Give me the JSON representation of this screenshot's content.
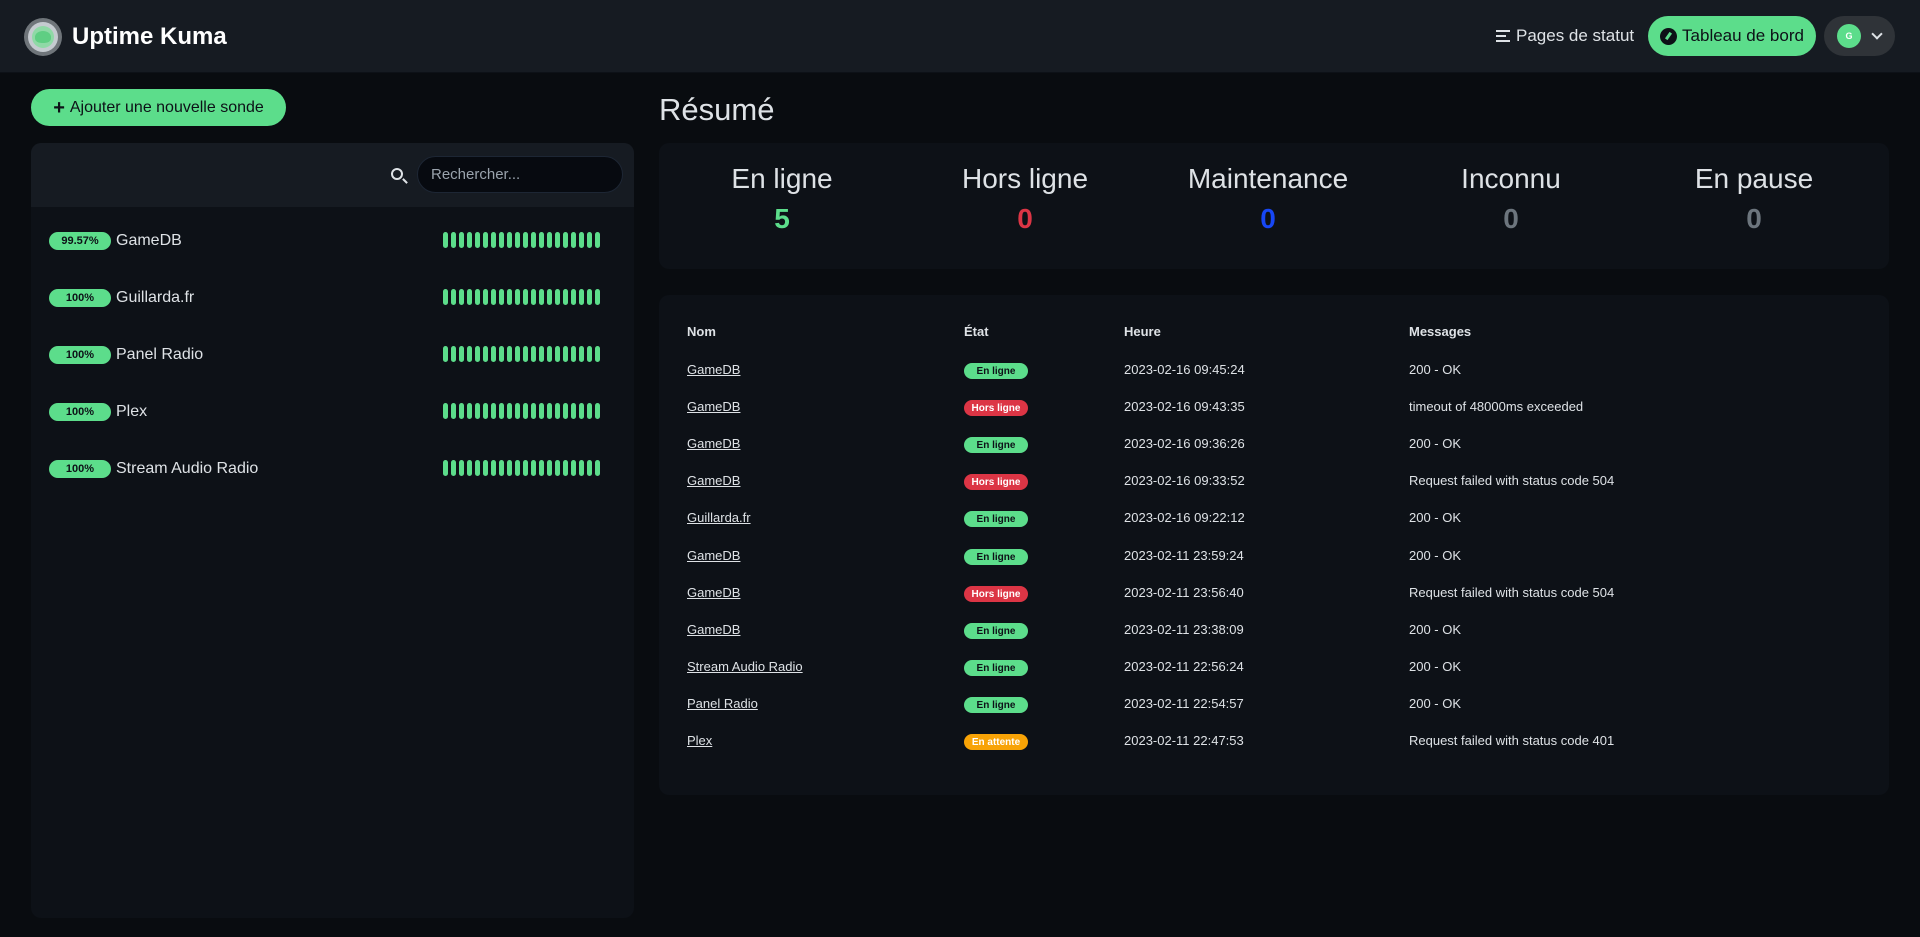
{
  "header": {
    "app_title": "Uptime Kuma",
    "status_pages_label": "Pages de statut",
    "dashboard_label": "Tableau de bord",
    "avatar_initial": "G",
    "logo_icon": "uptime-kuma-logo-icon"
  },
  "sidebar": {
    "add_button_label": "Ajouter une nouvelle sonde",
    "search_placeholder": "Rechercher...",
    "monitors": [
      {
        "uptime": "99.57%",
        "name": "GameDB"
      },
      {
        "uptime": "100%",
        "name": "Guillarda.fr"
      },
      {
        "uptime": "100%",
        "name": "Panel Radio"
      },
      {
        "uptime": "100%",
        "name": "Plex"
      },
      {
        "uptime": "100%",
        "name": "Stream Audio Radio"
      }
    ],
    "heartbeat_color": "#5cdd8b"
  },
  "summary": {
    "title": "Résumé",
    "stats": [
      {
        "label": "En ligne",
        "value": "5",
        "color": "#5cdd8b"
      },
      {
        "label": "Hors ligne",
        "value": "0",
        "color": "#dc3545"
      },
      {
        "label": "Maintenance",
        "value": "0",
        "color": "#1747f5"
      },
      {
        "label": "Inconnu",
        "value": "0",
        "color": "#6c757d"
      },
      {
        "label": "En pause",
        "value": "0",
        "color": "#6c757d"
      }
    ]
  },
  "events": {
    "headers": {
      "name": "Nom",
      "state": "État",
      "time": "Heure",
      "message": "Messages"
    },
    "rows": [
      {
        "name": "GameDB",
        "state": "En ligne",
        "status": "up",
        "time": "2023-02-16 09:45:24",
        "message": "200 - OK"
      },
      {
        "name": "GameDB",
        "state": "Hors ligne",
        "status": "down",
        "time": "2023-02-16 09:43:35",
        "message": "timeout of 48000ms exceeded"
      },
      {
        "name": "GameDB",
        "state": "En ligne",
        "status": "up",
        "time": "2023-02-16 09:36:26",
        "message": "200 - OK"
      },
      {
        "name": "GameDB",
        "state": "Hors ligne",
        "status": "down",
        "time": "2023-02-16 09:33:52",
        "message": "Request failed with status code 504"
      },
      {
        "name": "Guillarda.fr",
        "state": "En ligne",
        "status": "up",
        "time": "2023-02-16 09:22:12",
        "message": "200 - OK"
      },
      {
        "name": "GameDB",
        "state": "En ligne",
        "status": "up",
        "time": "2023-02-11 23:59:24",
        "message": "200 - OK"
      },
      {
        "name": "GameDB",
        "state": "Hors ligne",
        "status": "down",
        "time": "2023-02-11 23:56:40",
        "message": "Request failed with status code 504"
      },
      {
        "name": "GameDB",
        "state": "En ligne",
        "status": "up",
        "time": "2023-02-11 23:38:09",
        "message": "200 - OK"
      },
      {
        "name": "Stream Audio Radio",
        "state": "En ligne",
        "status": "up",
        "time": "2023-02-11 22:56:24",
        "message": "200 - OK"
      },
      {
        "name": "Panel Radio",
        "state": "En ligne",
        "status": "up",
        "time": "2023-02-11 22:54:57",
        "message": "200 - OK"
      },
      {
        "name": "Plex",
        "state": "En attente",
        "status": "pending",
        "time": "2023-02-11 22:47:53",
        "message": "Request failed with status code 401"
      }
    ],
    "status_colors": {
      "up": "#5cdd8b",
      "down": "#dc3545",
      "pending": "#f8a306"
    }
  }
}
